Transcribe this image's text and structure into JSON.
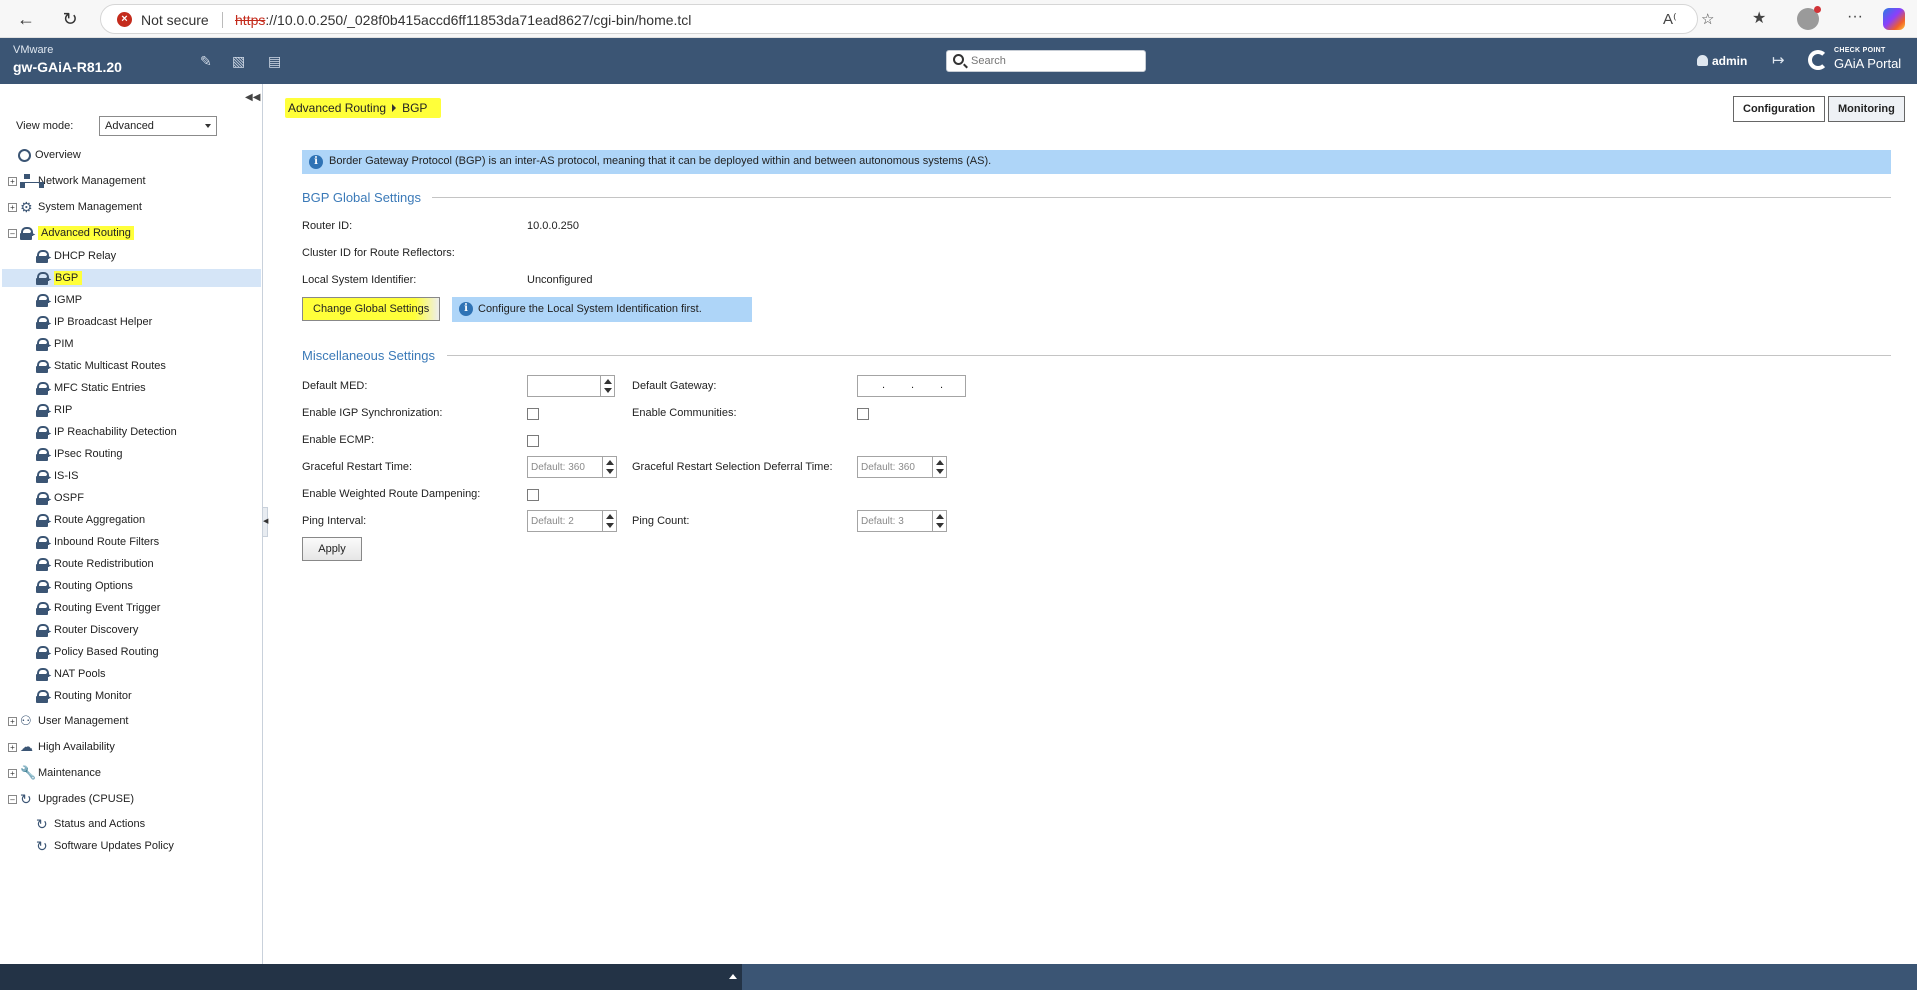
{
  "browser": {
    "security_label": "Not secure",
    "url_scheme": "https",
    "url_rest": "://10.0.0.250/_028f0b415accd6ff11853da71ead8627/cgi-bin/home.tcl",
    "notification_count": "1"
  },
  "header": {
    "vendor": "VMware",
    "hostname": "gw-GAiA-R81.20",
    "search_placeholder": "Search",
    "user": "admin",
    "logo_top": "CHECK POINT",
    "logo_bottom": "GAiA Portal"
  },
  "sidebar": {
    "view_mode_label": "View mode:",
    "view_mode_value": "Advanced",
    "items": [
      {
        "label": "Overview"
      },
      {
        "label": "Network Management"
      },
      {
        "label": "System Management"
      },
      {
        "label": "Advanced Routing"
      },
      {
        "label": "DHCP Relay"
      },
      {
        "label": "BGP"
      },
      {
        "label": "IGMP"
      },
      {
        "label": "IP Broadcast Helper"
      },
      {
        "label": "PIM"
      },
      {
        "label": "Static Multicast Routes"
      },
      {
        "label": "MFC Static Entries"
      },
      {
        "label": "RIP"
      },
      {
        "label": "IP Reachability Detection"
      },
      {
        "label": "IPsec Routing"
      },
      {
        "label": "IS-IS"
      },
      {
        "label": "OSPF"
      },
      {
        "label": "Route Aggregation"
      },
      {
        "label": "Inbound Route Filters"
      },
      {
        "label": "Route Redistribution"
      },
      {
        "label": "Routing Options"
      },
      {
        "label": "Routing Event Trigger"
      },
      {
        "label": "Router Discovery"
      },
      {
        "label": "Policy Based Routing"
      },
      {
        "label": "NAT Pools"
      },
      {
        "label": "Routing Monitor"
      },
      {
        "label": "User Management"
      },
      {
        "label": "High Availability"
      },
      {
        "label": "Maintenance"
      },
      {
        "label": "Upgrades (CPUSE)"
      },
      {
        "label": "Status and Actions"
      },
      {
        "label": "Software Updates Policy"
      }
    ]
  },
  "main": {
    "breadcrumb": [
      "Advanced Routing",
      "BGP"
    ],
    "tabs": [
      "Configuration",
      "Monitoring"
    ],
    "info_text": "Border Gateway Protocol (BGP) is an inter-AS protocol, meaning that it can be deployed within and between autonomous systems (AS).",
    "global": {
      "title": "BGP Global Settings",
      "router_id_label": "Router ID:",
      "router_id_value": "10.0.0.250",
      "cluster_id_label": "Cluster ID for Route Reflectors:",
      "cluster_id_value": "",
      "local_system_label": "Local System Identifier:",
      "local_system_value": "Unconfigured",
      "change_button": "Change Global Settings",
      "hint": "Configure the Local System Identification first."
    },
    "misc": {
      "title": "Miscellaneous Settings",
      "default_med_label": "Default MED:",
      "default_med_value": "",
      "default_gateway_label": "Default Gateway:",
      "igp_sync_label": "Enable IGP Synchronization:",
      "communities_label": "Enable Communities:",
      "ecmp_label": "Enable ECMP:",
      "graceful_restart_label": "Graceful Restart Time:",
      "graceful_restart_placeholder": "Default: 360",
      "deferral_label": "Graceful Restart Selection Deferral Time:",
      "deferral_placeholder": "Default: 360",
      "dampening_label": "Enable Weighted Route Dampening:",
      "ping_interval_label": "Ping Interval:",
      "ping_interval_placeholder": "Default: 2",
      "ping_count_label": "Ping Count:",
      "ping_count_placeholder": "Default: 3",
      "apply_button": "Apply"
    }
  }
}
